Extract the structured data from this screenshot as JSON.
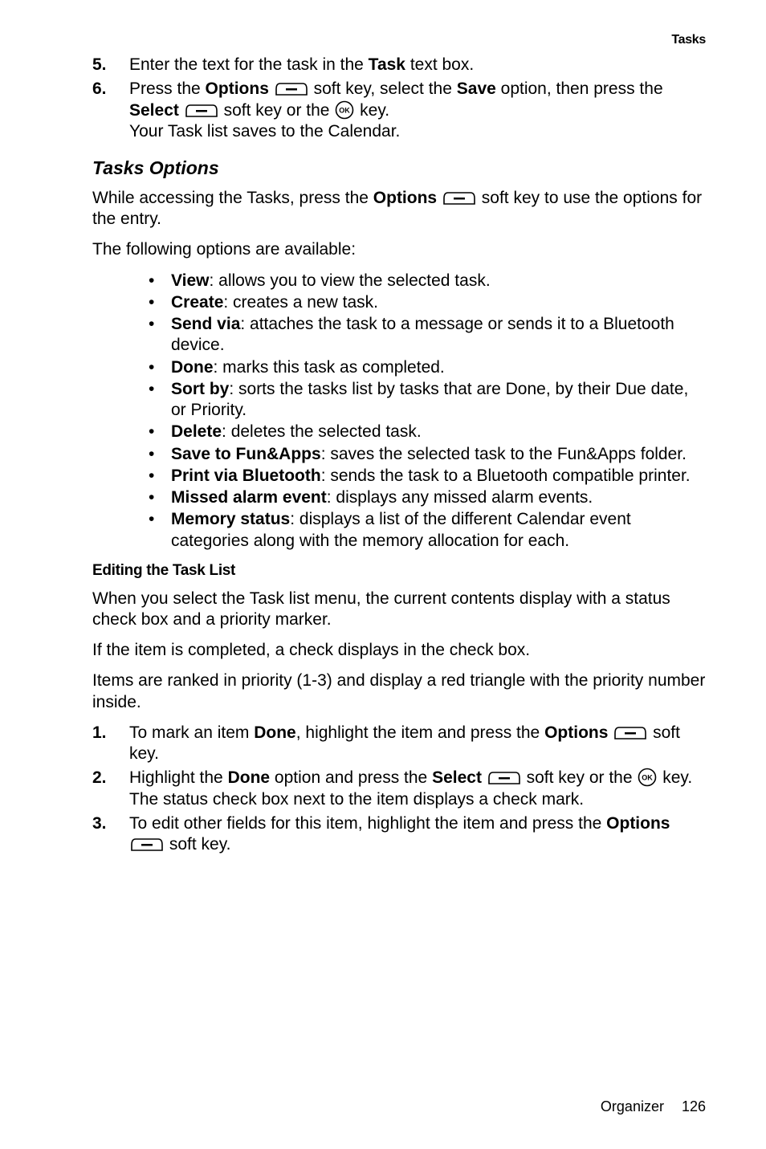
{
  "header": {
    "title": "Tasks"
  },
  "steps_a": {
    "5": {
      "num": "5.",
      "pre": "Enter the text for the task in the ",
      "bold1": "Task",
      "post1": " text box."
    },
    "6": {
      "num": "6.",
      "line1_pre": "Press the ",
      "line1_b1": "Options",
      "line1_mid1": " soft key, select the ",
      "line1_b2": "Save",
      "line1_post1": " option, then press the ",
      "line2_b1": "Select",
      "line2_mid": " soft key or the ",
      "line2_post": " key.",
      "line3": "Your Task list saves to the Calendar."
    }
  },
  "section1": {
    "title": "Tasks Options",
    "intro_pre": "While accessing the Tasks, press the ",
    "intro_b1": "Options",
    "intro_post": " soft key to use the options for the entry.",
    "avail": "The following options are available:",
    "bullets": [
      {
        "label": "View",
        "desc": ": allows you to view the selected task."
      },
      {
        "label": "Create",
        "desc": ": creates a new task."
      },
      {
        "label": "Send via",
        "desc": ": attaches the task to a message or sends it to a Bluetooth device."
      },
      {
        "label": "Done",
        "desc": ": marks this task as completed."
      },
      {
        "label": "Sort by",
        "desc": ": sorts the tasks list by tasks that are Done, by their Due date, or Priority."
      },
      {
        "label": "Delete",
        "desc": ": deletes the selected task."
      },
      {
        "label": "Save to Fun&Apps",
        "desc": ": saves the selected task to the Fun&Apps folder."
      },
      {
        "label": "Print via Bluetooth",
        "desc": ": sends the task to a Bluetooth compatible printer."
      },
      {
        "label": "Missed alarm event",
        "desc": ": displays any missed alarm events."
      },
      {
        "label": "Memory status",
        "desc": ": displays a list of the different Calendar event categories along with the memory allocation for each."
      }
    ]
  },
  "section2": {
    "title": "Editing the Task List",
    "p1": "When you select the Task list menu, the current contents display with a status check box and a priority marker.",
    "p2": "If the item is completed, a check displays in the check box.",
    "p3": "Items are ranked in priority (1-3) and display a red triangle with the priority number inside."
  },
  "steps_b": {
    "1": {
      "num": "1.",
      "pre": "To mark an item ",
      "b1": "Done",
      "mid1": ", highlight the item and press the ",
      "b2": "Options",
      "post": " soft key."
    },
    "2": {
      "num": "2.",
      "pre": "Highlight the ",
      "b1": "Done",
      "mid1": " option and press the ",
      "b2": "Select",
      "post1": " soft key or the ",
      "post2": " key.",
      "line2": "The status check box next to the item displays a check mark."
    },
    "3": {
      "num": "3.",
      "pre": "To edit other fields for this item, highlight the item and press the ",
      "b1": "Options",
      "post": " soft key."
    }
  },
  "footer": {
    "chapter": "Organizer",
    "page": "126"
  }
}
